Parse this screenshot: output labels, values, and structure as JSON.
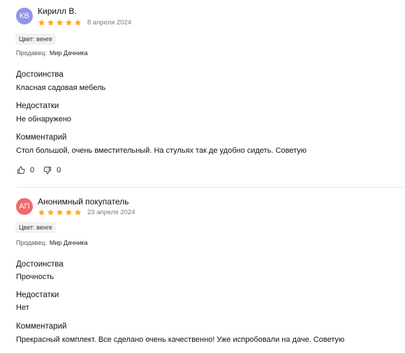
{
  "colors": {
    "star": "#ffa832",
    "avatar1": "#8f96e8",
    "avatar2": "#ee6a6a"
  },
  "reviews": [
    {
      "avatar": "КВ",
      "author": "Кирилл В.",
      "rating": 5,
      "date": "8 апреля 2024",
      "variant": "Цвет: венге",
      "seller_label": "Продавец:",
      "seller_name": "Мир Дачника",
      "pros_title": "Достоинства",
      "pros": "Класная садовая мебель",
      "cons_title": "Недостатки",
      "cons": "Не обнаружено",
      "comment_title": "Комментарий",
      "comment": "Стол большой, очень вместительный. На стульях так де удобно сидеть. Советую",
      "likes": "0",
      "dislikes": "0"
    },
    {
      "avatar": "АП",
      "author": "Анонимный покупатель",
      "rating": 5,
      "date": "23 апреля 2024",
      "variant": "Цвет: венге",
      "seller_label": "Продавец:",
      "seller_name": "Мир Дачника",
      "pros_title": "Достоинства",
      "pros": "Прочность",
      "cons_title": "Недостатки",
      "cons": "Нет",
      "comment_title": "Комментарий",
      "comment": "Прекрасный комплект. Все сделано очень качественно! Уже испробовали на даче. Советую"
    }
  ]
}
